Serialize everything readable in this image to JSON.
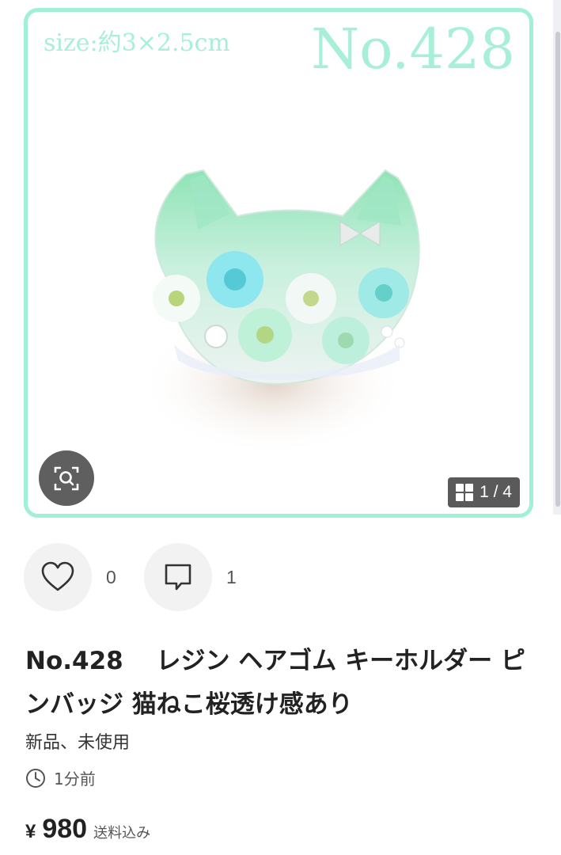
{
  "image": {
    "size_text": "size:約3×2.5cm",
    "number_text": "No.428",
    "counter": "1 / 4",
    "frame_color": "#9ff0d4",
    "lens_icon": "image-search-icon",
    "grid_icon": "gallery-grid-icon"
  },
  "reactions": {
    "likes": "0",
    "comments": "1",
    "like_icon": "heart-icon",
    "comment_icon": "comment-icon"
  },
  "item": {
    "title": "No.428　 レジン ヘアゴム キーホルダー ピンバッジ 猫ねこ桜透け感あり",
    "condition": "新品、未使用",
    "posted_time": "1分前",
    "clock_icon": "clock-icon",
    "currency": "¥",
    "price": "980",
    "shipping_note": "送料込み"
  }
}
